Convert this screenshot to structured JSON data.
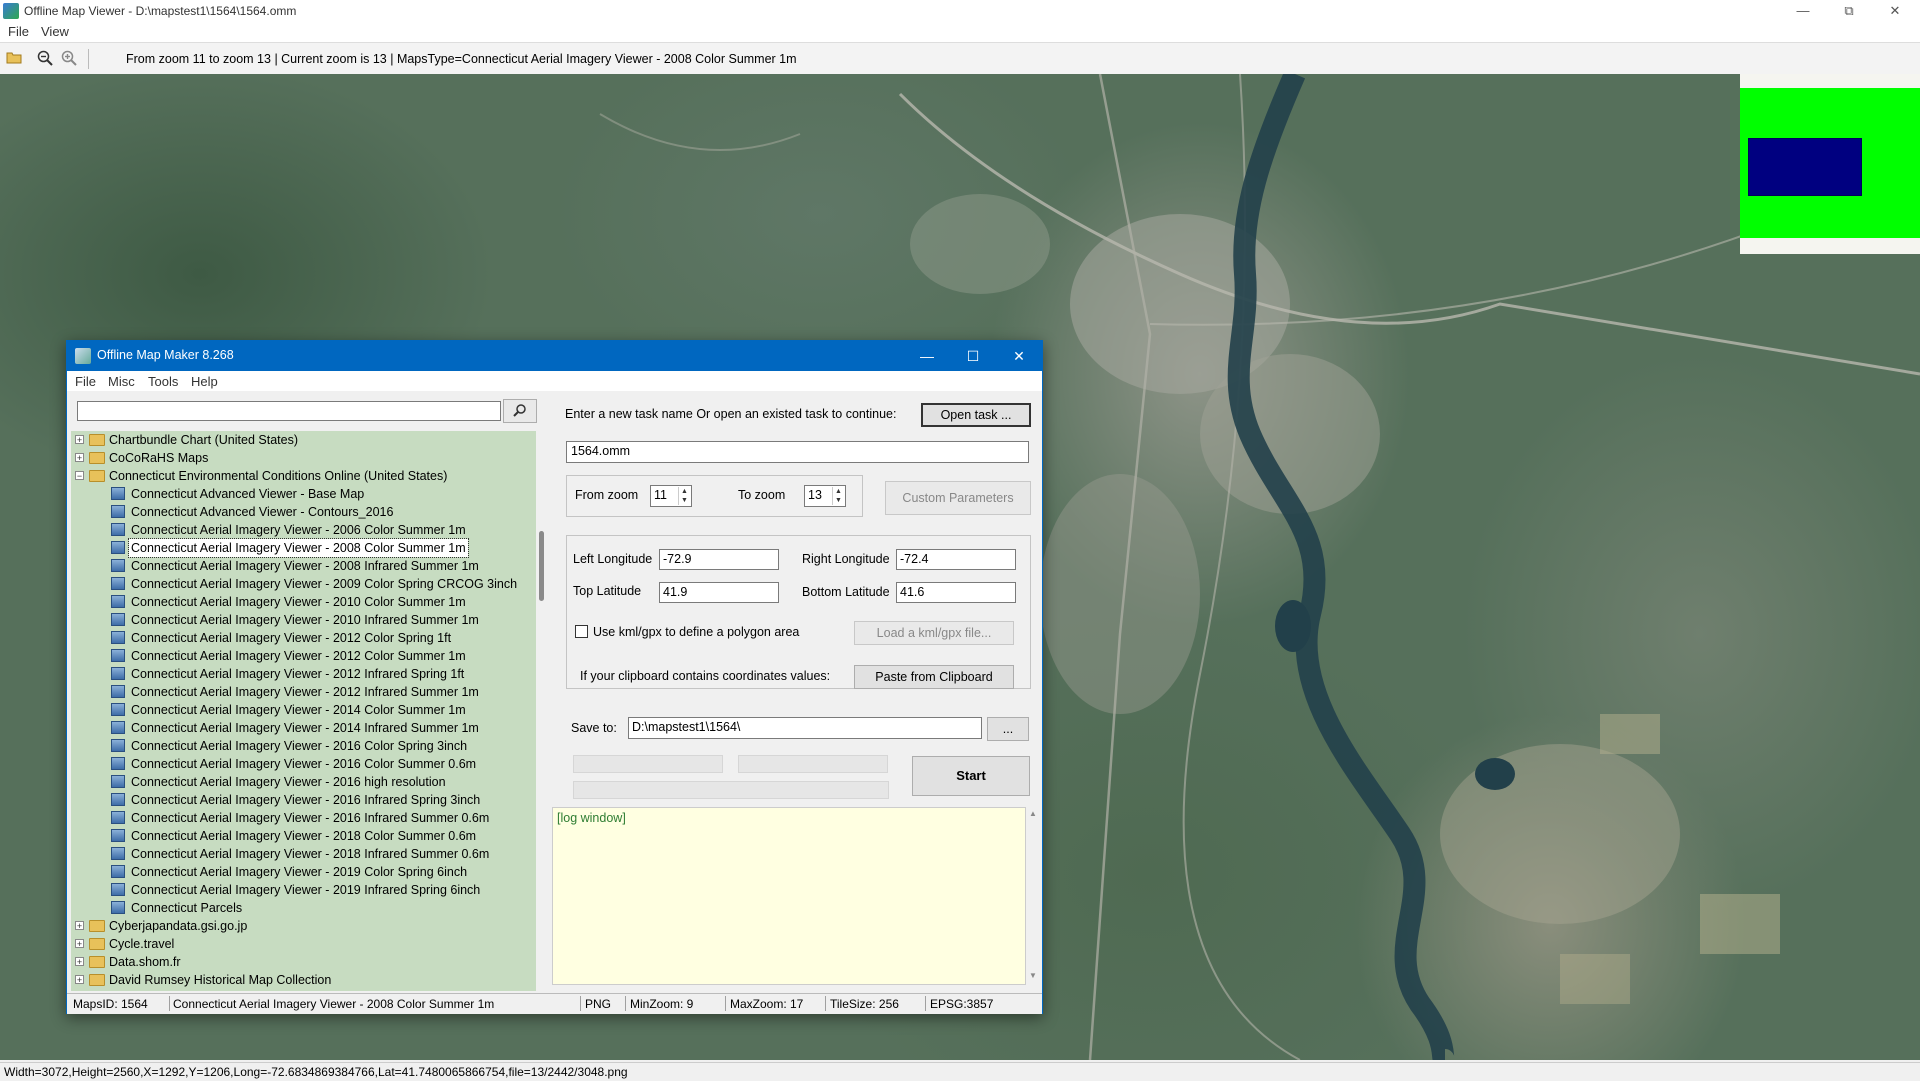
{
  "viewer": {
    "title": "Offline Map Viewer - D:\\mapstest1\\1564\\1564.omm",
    "menu": [
      "File",
      "View"
    ],
    "toolbar": {
      "open_icon": "folder-open-icon",
      "zoom_out_icon": "zoom-out-icon",
      "zoom_in_icon": "zoom-in-icon",
      "info": "From zoom 11 to zoom 13   |   Current zoom is 13   |   MapsType=Connecticut Aerial Imagery Viewer - 2008 Color Summer 1m"
    },
    "status": "Width=3072,Height=2560,X=1292,Y=1206,Long=-72.6834869384766,Lat=41.7480065866754,file=13/2442/3048.png",
    "overview_colors": {
      "frame": "#00ff00",
      "view": "#000080"
    }
  },
  "maker": {
    "title": "Offline Map Maker 8.268",
    "menu": [
      "File",
      "Misc",
      "Tools",
      "Help"
    ],
    "search": {
      "value": "",
      "icon": "search-icon"
    },
    "tree": [
      {
        "level": 0,
        "type": "folder",
        "expanded": false,
        "label": "Chartbundle Chart (United States)"
      },
      {
        "level": 0,
        "type": "folder",
        "expanded": false,
        "label": "CoCoRaHS Maps"
      },
      {
        "level": 0,
        "type": "folder",
        "expanded": true,
        "label": "Connecticut Environmental Conditions Online (United States)"
      },
      {
        "level": 1,
        "type": "map",
        "label": "Connecticut Advanced Viewer - Base Map"
      },
      {
        "level": 1,
        "type": "map",
        "label": "Connecticut Advanced Viewer - Contours_2016"
      },
      {
        "level": 1,
        "type": "map",
        "label": "Connecticut Aerial Imagery Viewer - 2006 Color Summer 1m"
      },
      {
        "level": 1,
        "type": "map",
        "label": "Connecticut Aerial Imagery Viewer - 2008 Color Summer 1m",
        "selected": true
      },
      {
        "level": 1,
        "type": "map",
        "label": "Connecticut Aerial Imagery Viewer - 2008 Infrared Summer 1m"
      },
      {
        "level": 1,
        "type": "map",
        "label": "Connecticut Aerial Imagery Viewer - 2009 Color Spring CRCOG 3inch"
      },
      {
        "level": 1,
        "type": "map",
        "label": "Connecticut Aerial Imagery Viewer - 2010 Color Summer 1m"
      },
      {
        "level": 1,
        "type": "map",
        "label": "Connecticut Aerial Imagery Viewer - 2010 Infrared Summer 1m"
      },
      {
        "level": 1,
        "type": "map",
        "label": "Connecticut Aerial Imagery Viewer - 2012 Color Spring 1ft"
      },
      {
        "level": 1,
        "type": "map",
        "label": "Connecticut Aerial Imagery Viewer - 2012 Color Summer 1m"
      },
      {
        "level": 1,
        "type": "map",
        "label": "Connecticut Aerial Imagery Viewer - 2012 Infrared Spring 1ft"
      },
      {
        "level": 1,
        "type": "map",
        "label": "Connecticut Aerial Imagery Viewer - 2012 Infrared Summer 1m"
      },
      {
        "level": 1,
        "type": "map",
        "label": "Connecticut Aerial Imagery Viewer - 2014 Color Summer 1m"
      },
      {
        "level": 1,
        "type": "map",
        "label": "Connecticut Aerial Imagery Viewer - 2014 Infrared Summer 1m"
      },
      {
        "level": 1,
        "type": "map",
        "label": "Connecticut Aerial Imagery Viewer - 2016 Color Spring 3inch"
      },
      {
        "level": 1,
        "type": "map",
        "label": "Connecticut Aerial Imagery Viewer - 2016 Color Summer 0.6m"
      },
      {
        "level": 1,
        "type": "map",
        "label": "Connecticut Aerial Imagery Viewer - 2016 high resolution"
      },
      {
        "level": 1,
        "type": "map",
        "label": "Connecticut Aerial Imagery Viewer - 2016 Infrared Spring 3inch"
      },
      {
        "level": 1,
        "type": "map",
        "label": "Connecticut Aerial Imagery Viewer - 2016 Infrared Summer 0.6m"
      },
      {
        "level": 1,
        "type": "map",
        "label": "Connecticut Aerial Imagery Viewer - 2018 Color Summer 0.6m"
      },
      {
        "level": 1,
        "type": "map",
        "label": "Connecticut Aerial Imagery Viewer - 2018 Infrared Summer 0.6m"
      },
      {
        "level": 1,
        "type": "map",
        "label": "Connecticut Aerial Imagery Viewer - 2019 Color Spring 6inch"
      },
      {
        "level": 1,
        "type": "map",
        "label": "Connecticut Aerial Imagery Viewer - 2019 Infrared Spring 6inch"
      },
      {
        "level": 1,
        "type": "map",
        "label": "Connecticut Parcels"
      },
      {
        "level": 0,
        "type": "folder",
        "expanded": false,
        "label": "Cyberjapandata.gsi.go.jp"
      },
      {
        "level": 0,
        "type": "folder",
        "expanded": false,
        "label": "Cycle.travel"
      },
      {
        "level": 0,
        "type": "folder",
        "expanded": false,
        "label": "Data.shom.fr"
      },
      {
        "level": 0,
        "type": "folder",
        "expanded": false,
        "label": "David Rumsey Historical Map Collection"
      }
    ],
    "task": {
      "prompt": "Enter a new task name Or open an existed task to continue:",
      "open_label": "Open task ...",
      "name": "1564.omm"
    },
    "zoom": {
      "from_label": "From zoom",
      "from_value": "11",
      "to_label": "To zoom",
      "to_value": "13",
      "custom_label": "Custom Parameters"
    },
    "coords": {
      "left_lon_label": "Left Longitude",
      "left_lon": "-72.9",
      "right_lon_label": "Right Longitude",
      "right_lon": "-72.4",
      "top_lat_label": "Top Latitude",
      "top_lat": "41.9",
      "bottom_lat_label": "Bottom Latitude",
      "bottom_lat": "41.6",
      "kml_label": "Use kml/gpx to define a polygon area",
      "kml_checked": false,
      "load_kml_label": "Load a kml/gpx file...",
      "clipboard_label": "If your clipboard contains coordinates values:",
      "paste_label": "Paste from Clipboard"
    },
    "save": {
      "label": "Save to:",
      "path": "D:\\mapstest1\\1564\\",
      "browse_label": "..."
    },
    "start_label": "Start",
    "log_text": "[log window]",
    "status": {
      "maps_id": "MapsID: 1564",
      "maps_name": "Connecticut Aerial Imagery Viewer - 2008 Color Summer 1m",
      "format": "PNG",
      "min_zoom": "MinZoom: 9",
      "max_zoom": "MaxZoom: 17",
      "tile_size": "TileSize: 256",
      "epsg": "EPSG:3857"
    }
  }
}
